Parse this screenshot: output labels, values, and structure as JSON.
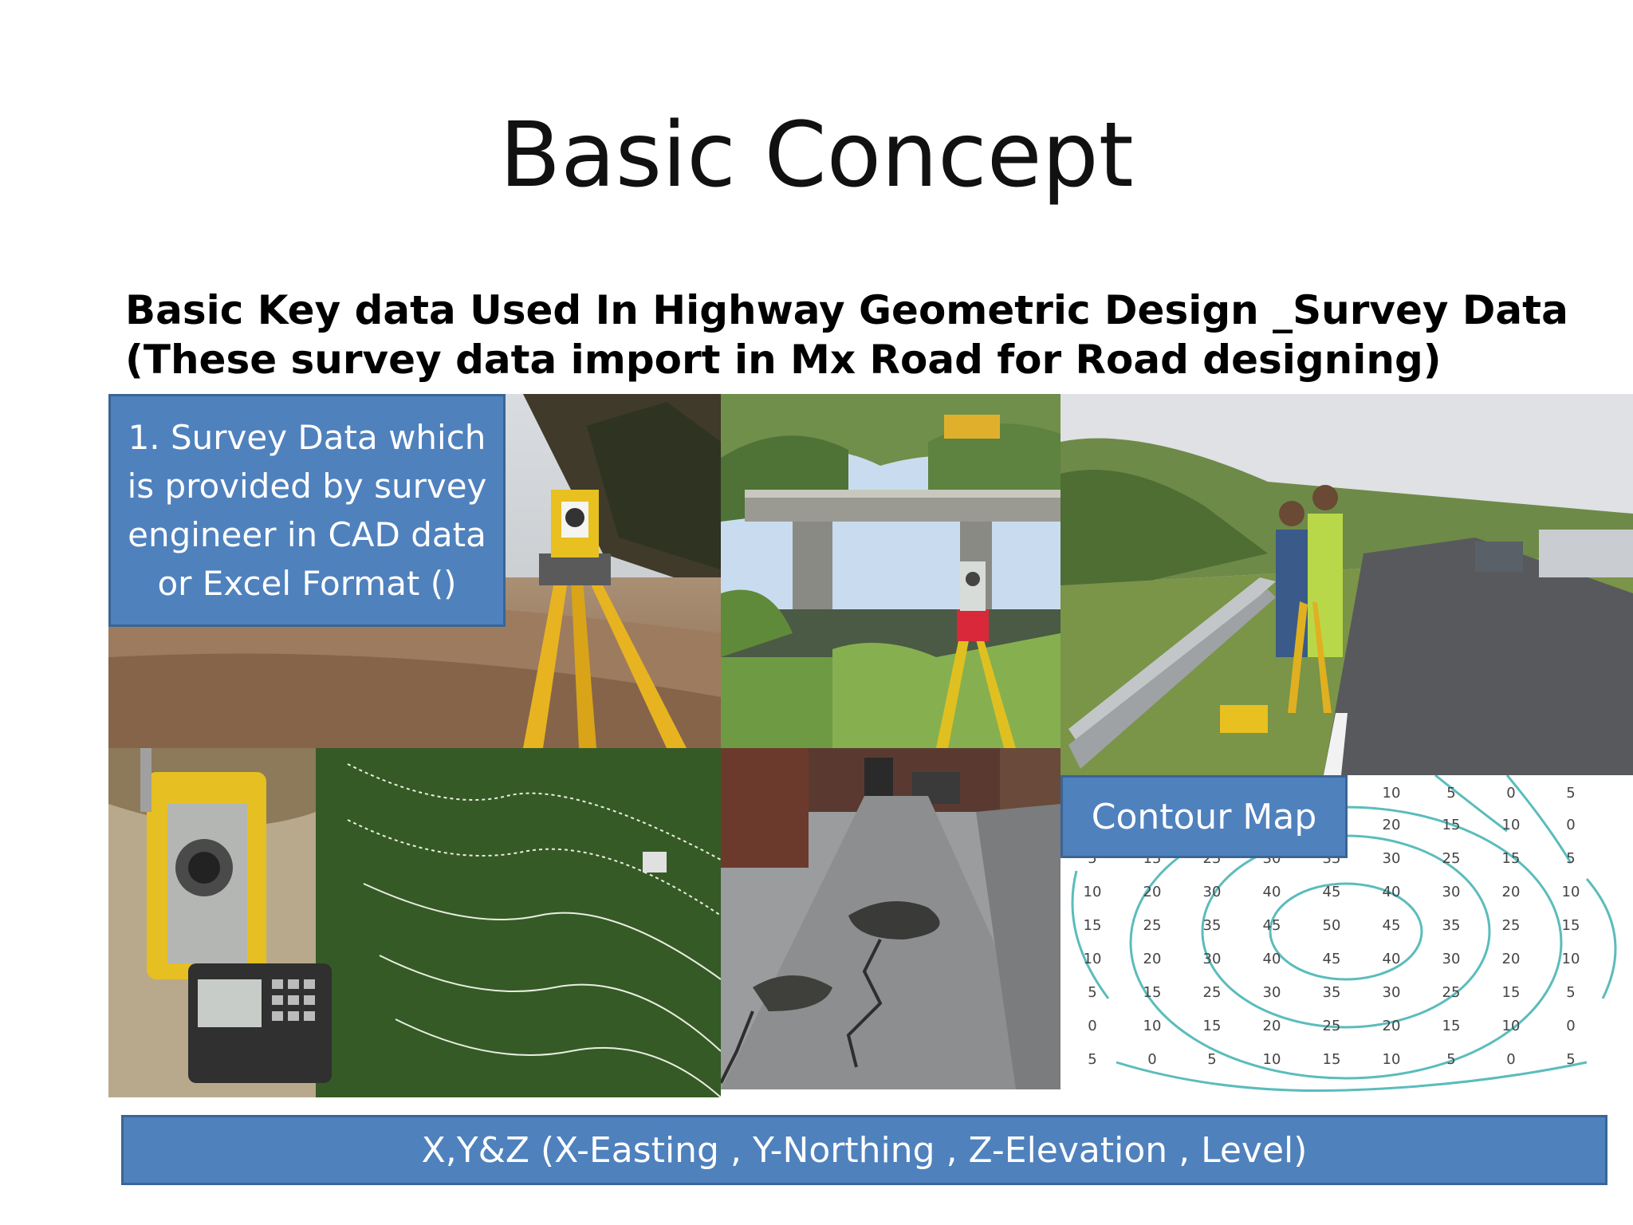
{
  "slide": {
    "title": "Basic Concept",
    "subtitle": "Basic Key data Used In Highway Geometric Design _Survey Data (These survey data import in Mx Road for Road designing)"
  },
  "callouts": {
    "survey": "1. Survey Data which is provided by survey engineer in CAD data or Excel Format ()",
    "contour": "Contour Map",
    "xyz": "X,Y&Z (X-Easting , Y-Northing , Z-Elevation , Level)"
  },
  "contour_grid": {
    "rows": [
      [
        "",
        "",
        "",
        "5",
        "10",
        "5",
        "0",
        "5"
      ],
      [
        "",
        "",
        "",
        "5",
        "20",
        "15",
        "10",
        "0"
      ],
      [
        "5",
        "15",
        "25",
        "30",
        "35",
        "30",
        "25",
        "15",
        "5"
      ],
      [
        "10",
        "20",
        "30",
        "40",
        "45",
        "40",
        "30",
        "20",
        "10"
      ],
      [
        "15",
        "25",
        "35",
        "45",
        "50",
        "45",
        "35",
        "25",
        "15"
      ],
      [
        "10",
        "20",
        "30",
        "40",
        "45",
        "40",
        "30",
        "20",
        "10"
      ],
      [
        "5",
        "15",
        "25",
        "30",
        "35",
        "30",
        "25",
        "15",
        "5"
      ],
      [
        "0",
        "10",
        "15",
        "20",
        "25",
        "20",
        "15",
        "10",
        "0"
      ],
      [
        "5",
        "0",
        "5",
        "10",
        "15",
        "10",
        "5",
        "0",
        "5"
      ]
    ]
  },
  "colors": {
    "callout_fill": "#4f81bd",
    "callout_border": "#3a6595",
    "contour_line": "#5bbcbc"
  }
}
